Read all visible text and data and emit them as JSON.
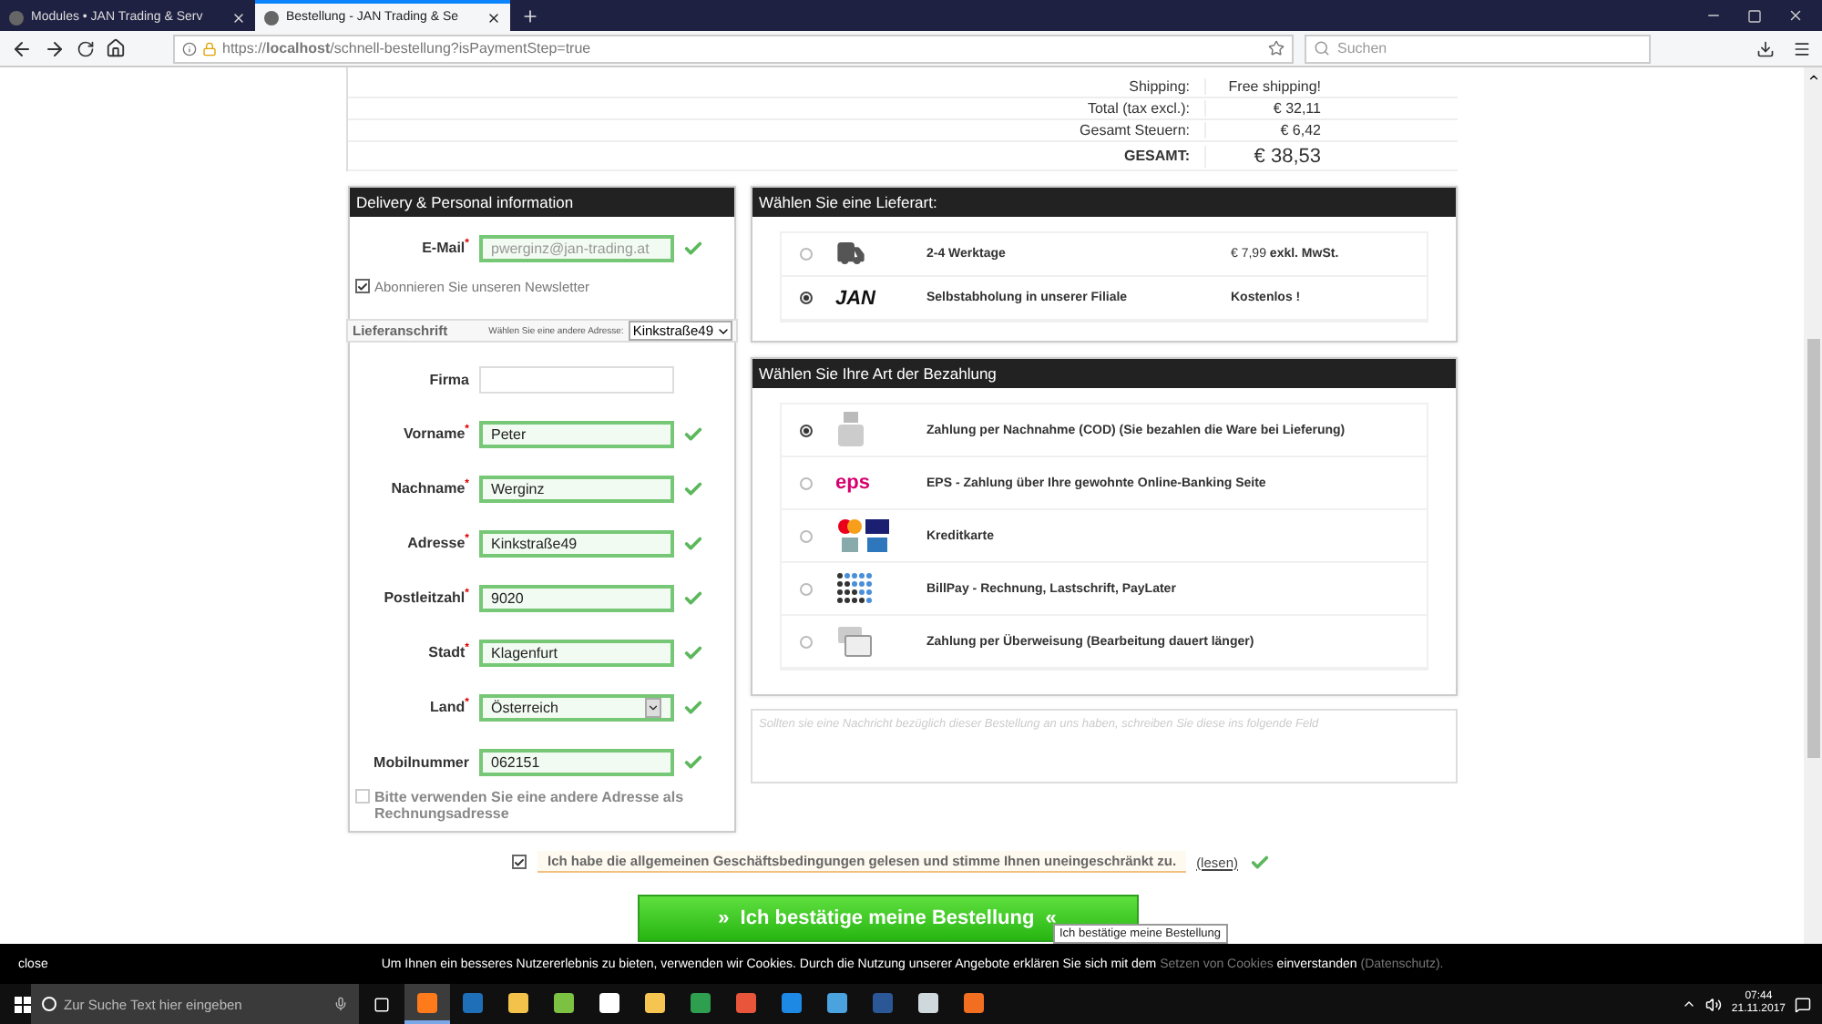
{
  "browser": {
    "tabs": [
      {
        "title": "Modules • JAN Trading & Serv",
        "selected": false
      },
      {
        "title": "Bestellung - JAN Trading & Se",
        "selected": true
      }
    ],
    "url": "https://**localhost**/schnell-bestellung?isPaymentStep=true",
    "search": {
      "placeholder": "Suchen"
    }
  },
  "summary": [
    {
      "label": "Shipping:",
      "value": "Free shipping!",
      "kind": "row"
    },
    {
      "label": "Total (tax excl.):",
      "value": "€ 32,11",
      "kind": "row"
    },
    {
      "label": "Gesamt Steuern:",
      "value": "€ 6,42",
      "kind": "row"
    },
    {
      "label": "GESAMT:",
      "value": "€ 38,53",
      "kind": "total"
    }
  ],
  "personal": {
    "title": "Delivery & Personal information",
    "email": {
      "label": "E-Mail",
      "mark": "*",
      "value": "pwerginz@jan-trading.at",
      "disabled": true,
      "valid": true
    },
    "newsletter": {
      "label": "Abonnieren Sie unseren Newsletter",
      "checked": true
    },
    "address_header": {
      "title": "Lieferanschrift",
      "hint": "Wählen Sie eine andere Adresse:",
      "value": "Kinkstraße49"
    },
    "fields": [
      {
        "label": "Firma",
        "kind": "input",
        "valid": false
      },
      {
        "label": "Vorname",
        "mark": "*",
        "kind": "input",
        "value": "Peter",
        "valid": true
      },
      {
        "label": "Nachname",
        "mark": "*",
        "kind": "input",
        "value": "Werginz",
        "valid": true
      },
      {
        "label": "Adresse",
        "mark": "*",
        "kind": "input",
        "value": "Kinkstraße49",
        "valid": true
      },
      {
        "label": "Postleitzahl",
        "mark": "*",
        "kind": "input",
        "value": "9020",
        "valid": true
      },
      {
        "label": "Stadt",
        "mark": "*",
        "kind": "input",
        "value": "Klagenfurt",
        "valid": true
      },
      {
        "label": "Land",
        "mark": "*",
        "kind": "select",
        "value": "Österreich",
        "valid": true
      },
      {
        "label": "Mobilnummer",
        "kind": "input",
        "value": "062151",
        "valid": true
      }
    ],
    "billing": {
      "label": "Bitte verwenden Sie eine andere Adresse als Rechnungsadresse",
      "checked": false
    }
  },
  "delivery": {
    "title": "Wählen Sie eine Lieferart:",
    "options": [
      {
        "kind": "truck",
        "name": "2-4 Werktage",
        "price": "€ 7,99 **exkl. MwSt.**",
        "selected": false
      },
      {
        "kind": "logo",
        "logo_text": "JAN",
        "name": "Selbstabholung in unserer Filiale",
        "price": "**Kostenlos !**",
        "selected": true
      }
    ]
  },
  "payment": {
    "title": "Wählen Sie Ihre Art der Bezahlung",
    "options": [
      {
        "kind": "cod",
        "label": "Zahlung per Nachnahme (COD) (Sie bezahlen die Ware bei Lieferung)",
        "selected": true
      },
      {
        "kind": "eps",
        "logo_text": "eps",
        "label": "EPS - Zahlung über Ihre gewohnte Online-Banking Seite",
        "selected": false
      },
      {
        "kind": "cards",
        "label": "Kreditkarte",
        "selected": false
      },
      {
        "kind": "billpay",
        "label": "BillPay - Rechnung, Lastschrift, PayLater",
        "selected": false
      },
      {
        "kind": "transfer",
        "label": "Zahlung per Überweisung (Bearbeitung dauert länger)",
        "selected": false
      }
    ]
  },
  "message": {
    "placeholder": "Sollten sie eine Nachricht bezüglich dieser Bestellung an uns haben, schreiben Sie diese ins folgende Feld"
  },
  "terms": {
    "checked": true,
    "text": "Ich habe die allgemeinen Geschäftsbedingungen gelesen und stimme Ihnen uneingeschränkt zu.",
    "link": "(lesen)",
    "valid": true
  },
  "confirm": {
    "label": "»  Ich bestätige meine Bestellung  «",
    "tooltip": "Ich bestätige meine Bestellung"
  },
  "cookie": {
    "close": "close",
    "text_before": "Um Ihnen ein besseres Nutzererlebnis zu bieten, verwenden wir Cookies. Durch die Nutzung unserer Angebote erklären Sie sich mit dem",
    "link": "Setzen von Cookies",
    "text_middle": "einverstanden",
    "link2": "(Datenschutz)."
  },
  "taskbar": {
    "search": {
      "placeholder": "Zur Suche Text hier eingeben"
    },
    "apps": [
      {
        "color": "#ff7a1a",
        "selected": true
      },
      {
        "color": "#1f6fb8",
        "selected": false
      },
      {
        "color": "#f2c24b",
        "selected": false
      },
      {
        "color": "#7cc142",
        "selected": false
      },
      {
        "color": "#ffffff",
        "selected": false
      },
      {
        "color": "#f5c451",
        "selected": false
      },
      {
        "color": "#2e9e4f",
        "selected": false
      },
      {
        "color": "#e8553a",
        "selected": false
      },
      {
        "color": "#1e88e5",
        "selected": false
      },
      {
        "color": "#4aa3df",
        "selected": false
      },
      {
        "color": "#2b5797",
        "selected": false
      },
      {
        "color": "#cfd8dc",
        "selected": false
      },
      {
        "color": "#f26f21",
        "selected": false
      }
    ],
    "time": "07:44",
    "date": "21.11.2017"
  }
}
